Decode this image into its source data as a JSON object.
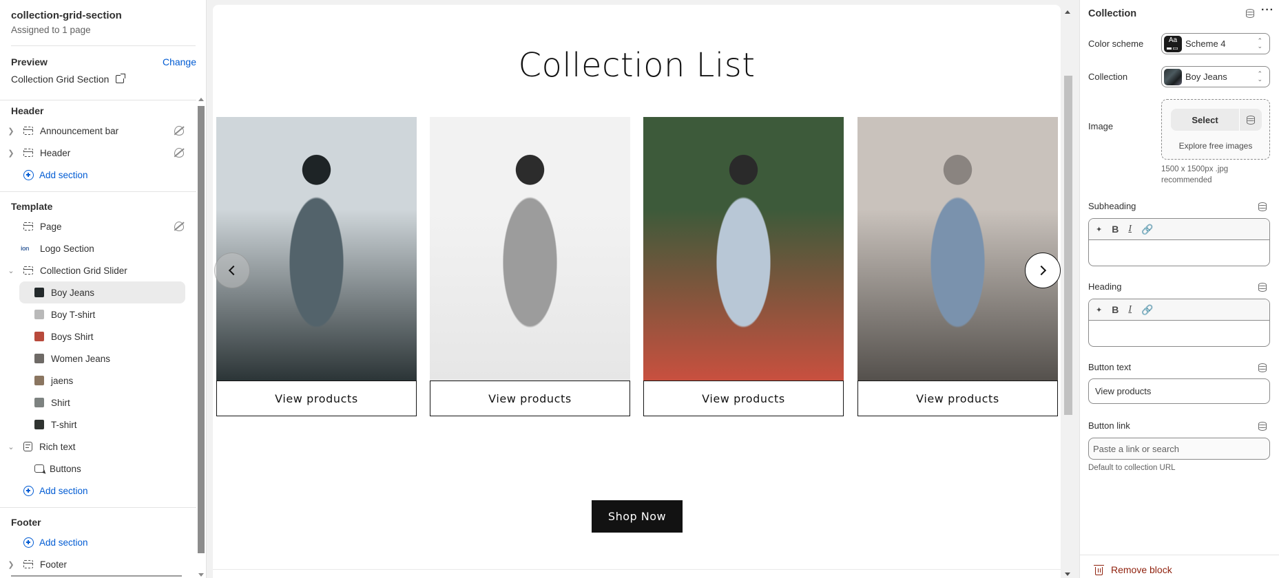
{
  "sidebar": {
    "title": "collection-grid-section",
    "subtitle": "Assigned to 1 page",
    "preview_label": "Preview",
    "change_label": "Change",
    "preview_name": "Collection Grid Section",
    "groups": {
      "header": {
        "title": "Header",
        "items": [
          {
            "label": "Announcement bar",
            "hidden": true
          },
          {
            "label": "Header",
            "hidden": true
          }
        ],
        "add_label": "Add section"
      },
      "template": {
        "title": "Template",
        "page": {
          "label": "Page",
          "hidden": true
        },
        "logo_section": {
          "label": "Logo Section",
          "icon_text": "ion"
        },
        "collection_grid_slider": {
          "label": "Collection Grid Slider",
          "blocks": [
            {
              "label": "Boy Jeans",
              "selected": true,
              "thumb": "#23292b"
            },
            {
              "label": "Boy T-shirt",
              "selected": false,
              "thumb": "#b9b9b9"
            },
            {
              "label": "Boys Shirt",
              "selected": false,
              "thumb": "#b84a3c"
            },
            {
              "label": "Women Jeans",
              "selected": false,
              "thumb": "#6e6a66"
            },
            {
              "label": "jaens",
              "selected": false,
              "thumb": "#8a7560"
            },
            {
              "label": "Shirt",
              "selected": false,
              "thumb": "#7d8280"
            },
            {
              "label": "T-shirt",
              "selected": false,
              "thumb": "#2f3330"
            }
          ]
        },
        "rich_text": {
          "label": "Rich text",
          "blocks": [
            {
              "label": "Buttons"
            }
          ]
        },
        "add_label": "Add section"
      },
      "footer": {
        "title": "Footer",
        "add_label": "Add section",
        "items": [
          {
            "label": "Footer"
          }
        ]
      }
    }
  },
  "preview": {
    "heading": "Collection List",
    "cards": [
      {
        "button": "View products",
        "image_desc": "man in green shirt sitting in car doorway",
        "colors": [
          "#cfd6da",
          "#2b3436",
          "#53636b",
          "#1e2426"
        ]
      },
      {
        "button": "View products",
        "image_desc": "man in grey t-shirt leaning against white wall",
        "colors": [
          "#f2f2f2",
          "#e6e6e6",
          "#9c9c9c",
          "#2c2c2c"
        ]
      },
      {
        "button": "View products",
        "image_desc": "man in red shirt and light jeans among plants",
        "colors": [
          "#3d5a3a",
          "#c9503f",
          "#b8c7d6",
          "#2a2a2a"
        ]
      },
      {
        "button": "View products",
        "image_desc": "woman in denim jacket in parking garage",
        "colors": [
          "#c9c2bc",
          "#54504c",
          "#7a92ad",
          "#8a8480"
        ]
      }
    ],
    "prev_icon": "chevron-left-icon",
    "next_icon": "chevron-right-icon",
    "cta_label": "Shop Now"
  },
  "panel": {
    "title": "Collection",
    "fields": {
      "color_scheme": {
        "label": "Color scheme",
        "value": "Scheme 4",
        "swatch_text": "Aa"
      },
      "collection": {
        "label": "Collection",
        "value": "Boy Jeans"
      },
      "image": {
        "label": "Image",
        "select_label": "Select",
        "explore_label": "Explore free images",
        "hint": "1500 x 1500px .jpg recommended"
      },
      "subheading": {
        "label": "Subheading",
        "value": ""
      },
      "heading": {
        "label": "Heading",
        "value": ""
      },
      "button_text": {
        "label": "Button text",
        "value": "View products"
      },
      "button_link": {
        "label": "Button link",
        "placeholder": "Paste a link or search",
        "note": "Default to collection URL"
      }
    },
    "rte_tools": {
      "ai": "✦",
      "bold": "B",
      "italic": "I",
      "link": "🔗"
    },
    "remove_label": "Remove block",
    "danger_color": "#8e1f0b"
  },
  "colors": {
    "accent": "#005bd3",
    "text": "#303030",
    "dark_button": "#121212"
  }
}
